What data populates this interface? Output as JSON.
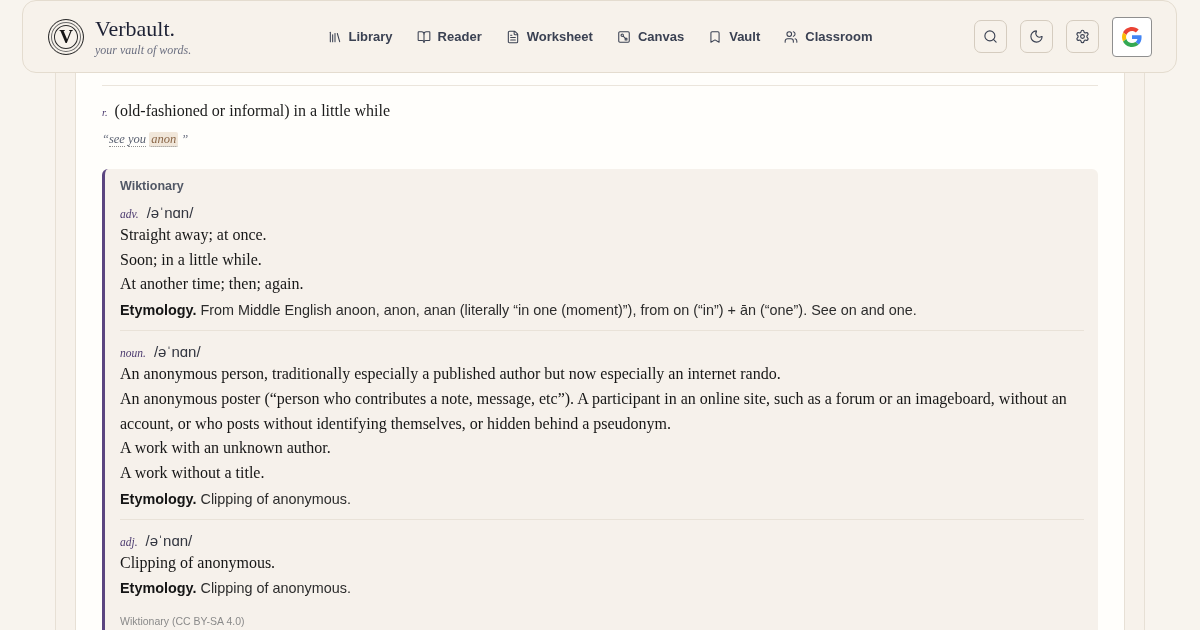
{
  "header": {
    "logo": {
      "mark": "V",
      "name": "Verbault.",
      "tagline": "your vault of words."
    },
    "nav": [
      {
        "kind": "library",
        "label": "Library"
      },
      {
        "kind": "reader",
        "label": "Reader"
      },
      {
        "kind": "worksheet",
        "label": "Worksheet"
      },
      {
        "kind": "canvas",
        "label": "Canvas"
      },
      {
        "kind": "vault",
        "label": "Vault"
      },
      {
        "kind": "classroom",
        "label": "Classroom"
      }
    ],
    "actions": [
      {
        "kind": "search"
      },
      {
        "kind": "theme"
      },
      {
        "kind": "settings"
      },
      {
        "kind": "google"
      }
    ]
  },
  "entry": {
    "senses": [
      {
        "pos": "r.",
        "definition": "(old-fashioned or informal) in a little while",
        "example": {
          "open_quote": "“",
          "words": [
            {
              "text": "see",
              "highlighted": false
            },
            {
              "text": "you",
              "highlighted": false
            },
            {
              "text": "anon",
              "highlighted": true
            }
          ],
          "close_quote": "”"
        }
      }
    ],
    "wiktionary": {
      "title": "Wiktionary",
      "sections": [
        {
          "pos": "adv.",
          "pronunciation": "/əˈnɑn/",
          "definitions": [
            "Straight away; at once.",
            "Soon; in a little while.",
            "At another time; then; again."
          ],
          "etymology": "**Etymology.** From Middle English anoon, anon, anan (literally “in one (moment)”), from on (“in”) + ān (“one”). See on and one."
        },
        {
          "pos": "noun.",
          "pronunciation": "/əˈnɑn/",
          "definitions": [
            "An anonymous person, traditionally especially a published author but now especially an internet rando.",
            "An anonymous poster (“person who contributes a note, message, etc”). A participant in an online site, such as a forum or an imageboard, without an account, or who posts without identifying themselves, or hidden behind a pseudonym.",
            "A work with an unknown author.",
            "A work without a title."
          ],
          "etymology": "**Etymology.** Clipping of anonymous."
        },
        {
          "pos": "adj.",
          "pronunciation": "/əˈnɑn/",
          "definitions": [
            "Clipping of anonymous."
          ],
          "etymology": "**Etymology.** Clipping of anonymous."
        }
      ],
      "footer": "Wiktionary (CC BY-SA 4.0)"
    }
  }
}
